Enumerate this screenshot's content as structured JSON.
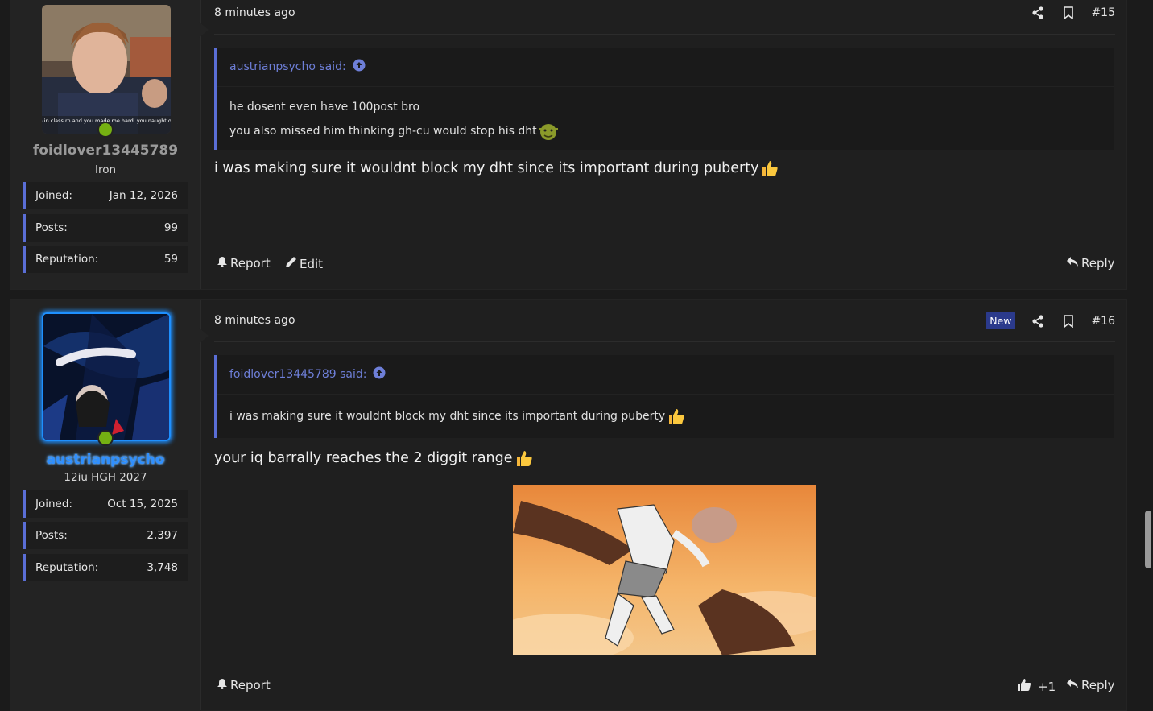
{
  "posts": [
    {
      "time": "8 minutes ago",
      "number": "#15",
      "is_new": false,
      "author": {
        "name": "foidlover13445789",
        "title": "Iron",
        "name_color": "#9a9a9a",
        "avatar_caption": "im in class rn and you made me hard. you naught   ore",
        "stats": [
          {
            "label": "Joined:",
            "value": "Jan 12, 2026"
          },
          {
            "label": "Posts:",
            "value": "99"
          },
          {
            "label": "Reputation:",
            "value": "59"
          }
        ]
      },
      "quote": {
        "author_said": "austrianpsycho said:",
        "lines": [
          "he dosent even have 100post bro",
          "you also missed him thinking gh-cu would stop his dht"
        ]
      },
      "body": "i was making sure it wouldnt block my dht since its important during puberty",
      "actions": {
        "report": "Report",
        "edit": "Edit",
        "reply": "Reply"
      }
    },
    {
      "time": "8 minutes ago",
      "number": "#16",
      "is_new": true,
      "new_label": "New",
      "author": {
        "name": "austrianpsycho",
        "title": "12iu HGH 2027",
        "name_color": "#2f8fff",
        "stats": [
          {
            "label": "Joined:",
            "value": "Oct 15, 2025"
          },
          {
            "label": "Posts:",
            "value": "2,397"
          },
          {
            "label": "Reputation:",
            "value": "3,748"
          }
        ]
      },
      "quote": {
        "author_said": "foidlover13445789 said:",
        "lines": [
          "i was making sure it wouldnt block my dht since its important during puberty"
        ]
      },
      "body": "your iq barrally reaches the 2 diggit range",
      "actions": {
        "report": "Report",
        "like_count": "+1",
        "reply": "Reply"
      }
    }
  ],
  "colors": {
    "accent": "#5a6ed6",
    "online": "#75b012",
    "quote_link": "#6e7fd8"
  },
  "icons": [
    "share-icon",
    "bookmark-icon",
    "arrow-up-circle-icon",
    "bell-icon",
    "pencil-icon",
    "reply-icon",
    "thumbs-up-icon"
  ]
}
